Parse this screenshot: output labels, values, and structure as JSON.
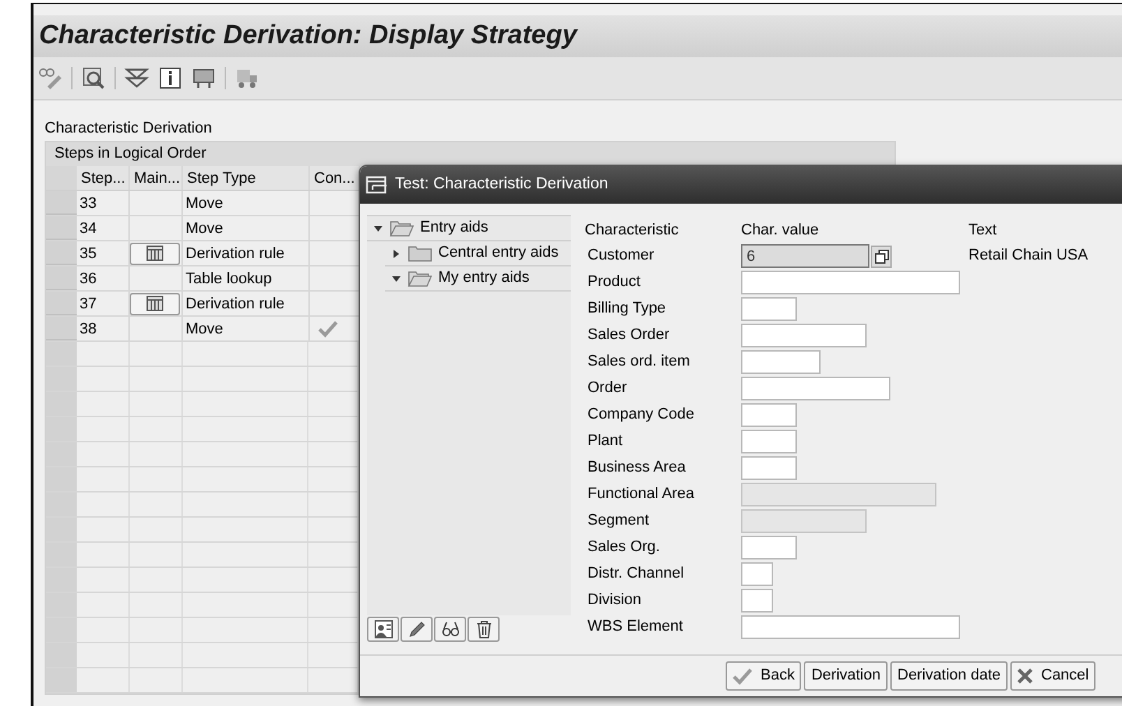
{
  "window": {
    "title": "Characteristic Derivation: Display Strategy"
  },
  "section_label": "Characteristic Derivation",
  "table": {
    "title": "Steps in Logical Order",
    "columns": [
      "Step...",
      "Main...",
      "Step Type",
      "Con..."
    ],
    "rows": [
      {
        "step": "33",
        "maintain": false,
        "step_type": "Move",
        "condition": false
      },
      {
        "step": "34",
        "maintain": false,
        "step_type": "Move",
        "condition": false
      },
      {
        "step": "35",
        "maintain": true,
        "step_type": "Derivation rule",
        "condition": false
      },
      {
        "step": "36",
        "maintain": false,
        "step_type": "Table lookup",
        "condition": false
      },
      {
        "step": "37",
        "maintain": true,
        "step_type": "Derivation rule",
        "condition": false
      },
      {
        "step": "38",
        "maintain": false,
        "step_type": "Move",
        "condition": true
      }
    ]
  },
  "dialog": {
    "title": "Test: Characteristic Derivation",
    "tree": [
      {
        "label": "Entry aids",
        "expanded": true,
        "children": [
          {
            "label": "Central entry aids",
            "expanded": false
          },
          {
            "label": "My entry aids",
            "expanded": true
          }
        ]
      }
    ],
    "columns": [
      "Characteristic",
      "Char. value",
      "Text"
    ],
    "fields": [
      {
        "label": "Customer",
        "value": "6",
        "disabled": false,
        "help": true,
        "text": "Retail Chain USA"
      },
      {
        "label": "Product",
        "disabled": false,
        "help": false
      },
      {
        "label": "Billing Type",
        "disabled": false,
        "help": false
      },
      {
        "label": "Sales Order",
        "disabled": false,
        "help": false
      },
      {
        "label": "Sales ord. item",
        "disabled": false,
        "help": false
      },
      {
        "label": "Order",
        "disabled": false,
        "help": false
      },
      {
        "label": "Company Code",
        "disabled": false,
        "help": false
      },
      {
        "label": "Plant",
        "disabled": false,
        "help": false
      },
      {
        "label": "Business Area",
        "disabled": false,
        "help": false
      },
      {
        "label": "Functional Area",
        "disabled": true,
        "help": false
      },
      {
        "label": "Segment",
        "disabled": true,
        "help": false
      },
      {
        "label": "Sales Org.",
        "disabled": false,
        "help": false
      },
      {
        "label": "Distr. Channel",
        "disabled": false,
        "help": false
      },
      {
        "label": "Division",
        "disabled": false,
        "help": false
      },
      {
        "label": "WBS Element",
        "disabled": false,
        "help": false
      }
    ],
    "buttons": [
      {
        "label": "Back",
        "kind": "back"
      },
      {
        "label": "Derivation",
        "kind": "plain"
      },
      {
        "label": "Derivation date",
        "kind": "plain"
      },
      {
        "label": "Cancel",
        "kind": "cancel"
      }
    ]
  }
}
